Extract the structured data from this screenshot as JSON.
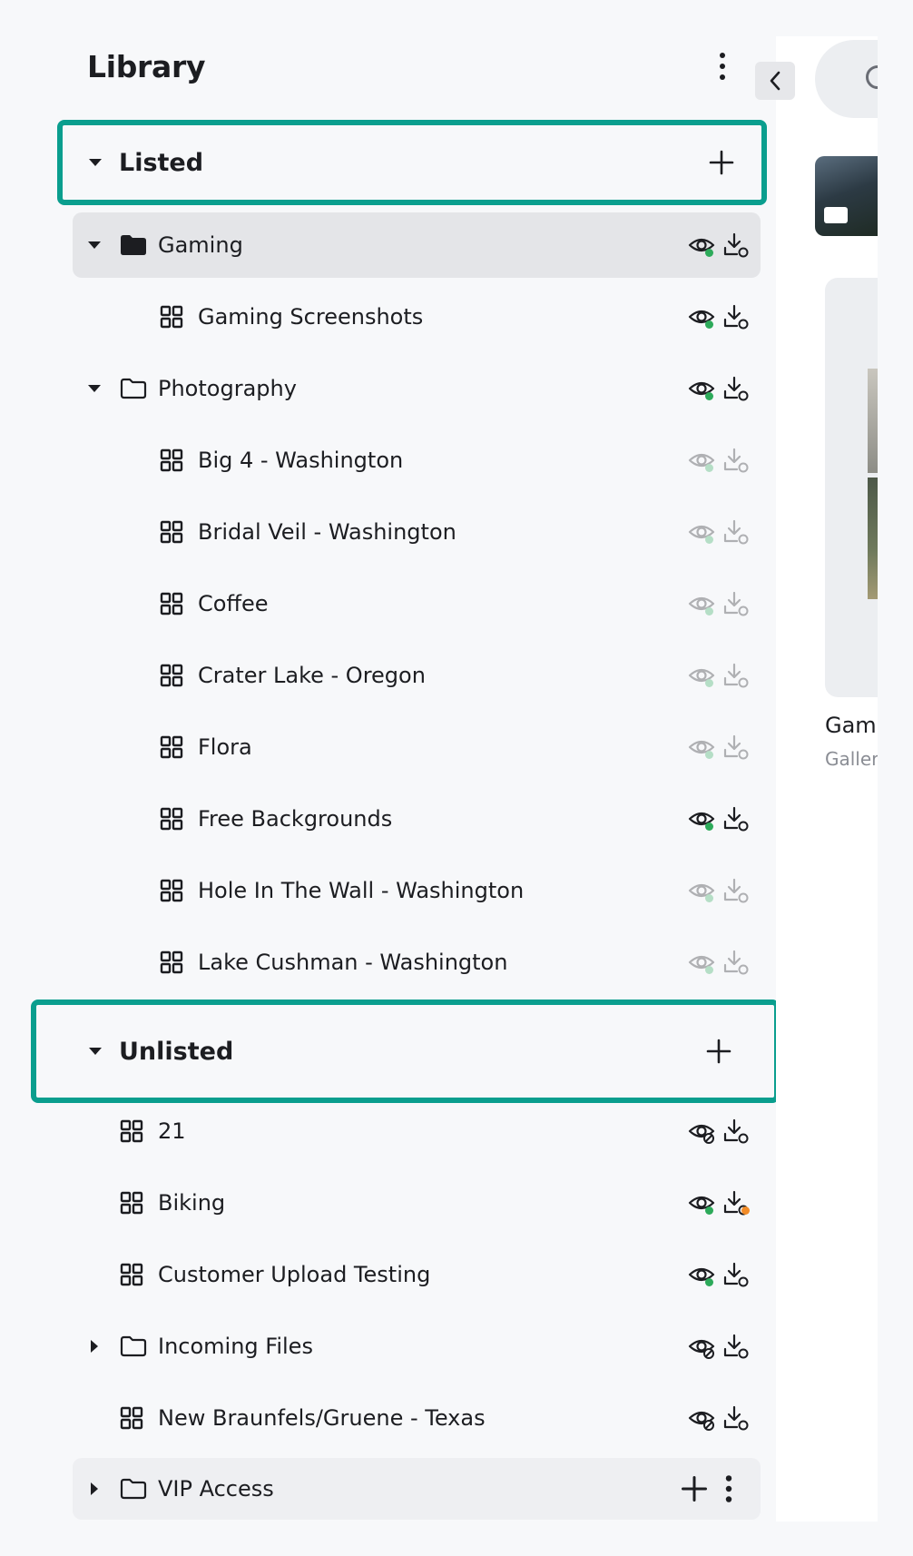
{
  "library": {
    "title": "Library"
  },
  "sections": {
    "listed": {
      "label": "Listed"
    },
    "unlisted": {
      "label": "Unlisted"
    }
  },
  "listed_items": [
    {
      "label": "Gaming",
      "type": "folder-filled",
      "expanded": true,
      "selected": true,
      "visibility": "visible",
      "status_dot": "green",
      "faded": false
    },
    {
      "label": "Gaming Screenshots",
      "type": "gallery",
      "indent": 2,
      "status_dot": "green",
      "faded": false
    },
    {
      "label": "Photography",
      "type": "folder",
      "expanded": true,
      "status_dot": "green",
      "faded": false
    },
    {
      "label": "Big 4 - Washington",
      "type": "gallery",
      "indent": 2,
      "status_dot": "green",
      "faded": true
    },
    {
      "label": "Bridal Veil - Washington",
      "type": "gallery",
      "indent": 2,
      "status_dot": "green",
      "faded": true
    },
    {
      "label": "Coffee",
      "type": "gallery",
      "indent": 2,
      "status_dot": "green",
      "faded": true
    },
    {
      "label": "Crater Lake - Oregon",
      "type": "gallery",
      "indent": 2,
      "status_dot": "green",
      "faded": true
    },
    {
      "label": "Flora",
      "type": "gallery",
      "indent": 2,
      "status_dot": "green",
      "faded": true
    },
    {
      "label": "Free Backgrounds",
      "type": "gallery",
      "indent": 2,
      "status_dot": "green",
      "faded": false
    },
    {
      "label": "Hole In The Wall - Washington",
      "type": "gallery",
      "indent": 2,
      "status_dot": "green",
      "faded": true
    },
    {
      "label": "Lake Cushman - Washington",
      "type": "gallery",
      "indent": 2,
      "status_dot": "green",
      "faded": true
    }
  ],
  "unlisted_items": [
    {
      "label": "21",
      "type": "gallery",
      "visibility": "hidden"
    },
    {
      "label": "Biking",
      "type": "gallery",
      "visibility": "visible",
      "status_dot": "green",
      "download_dot": "orange"
    },
    {
      "label": "Customer Upload Testing",
      "type": "gallery",
      "visibility": "visible",
      "status_dot": "green"
    },
    {
      "label": "Incoming Files",
      "type": "folder",
      "expanded": false,
      "visibility": "hidden"
    },
    {
      "label": "New Braunfels/Gruene - Texas",
      "type": "gallery",
      "visibility": "hidden"
    },
    {
      "label": "VIP Access",
      "type": "folder",
      "expanded": false,
      "actions": [
        "add",
        "more"
      ]
    }
  ],
  "panel": {
    "card_title": "Gam",
    "card_subtitle": "Galler"
  },
  "colors": {
    "accent": "#0a9e8e",
    "status_green": "#2daa5a",
    "status_orange": "#f28c28",
    "selected_row": "#e4e5e8"
  },
  "icons": {
    "caret_down": "caret-down-icon",
    "caret_right": "caret-right-icon",
    "folder": "folder-icon",
    "gallery": "grid-icon",
    "eye": "eye-icon",
    "download": "download-icon",
    "plus": "plus-icon",
    "more": "kebab-icon",
    "collapse": "chevron-left-icon"
  }
}
